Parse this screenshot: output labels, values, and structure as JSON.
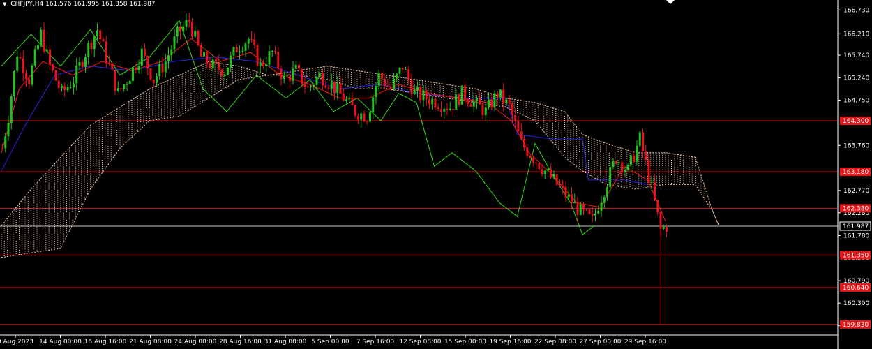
{
  "header": {
    "symbol": "CHFJPY,H4",
    "ohlc": "161.576 161.995 161.358 161.987"
  },
  "colors": {
    "background": "#000000",
    "axis": "#ffffff",
    "bull": "#22c41c",
    "bear": "#e8121a",
    "tenkan": "#ff1a1a",
    "kijun": "#2a22e8",
    "chikou": "#36d61a",
    "cloud": "#f0c8a8",
    "level": "#e0181c",
    "price_line": "#c8c8c8"
  },
  "chart_data": {
    "type": "candlestick",
    "price_axis_ticks": [
      166.73,
      166.21,
      165.74,
      165.24,
      164.75,
      163.76,
      162.77,
      162.28,
      161.78,
      161.29,
      160.79,
      160.3,
      159.8
    ],
    "x_tick_labels": [
      "9 Aug 2023",
      "14 Aug 00:00",
      "16 Aug 16:00",
      "21 Aug 08:00",
      "24 Aug 00:00",
      "28 Aug 16:00",
      "31 Aug 08:00",
      "5 Sep 00:00",
      "7 Sep 16:00",
      "12 Sep 08:00",
      "15 Sep 00:00",
      "19 Sep 16:00",
      "22 Sep 08:00",
      "27 Sep 00:00",
      "29 Sep 16:00"
    ],
    "levels": [
      {
        "value": 164.3,
        "label": "164.300"
      },
      {
        "value": 163.18,
        "label": "163.180"
      },
      {
        "value": 162.38,
        "label": "162.380"
      },
      {
        "value": 161.35,
        "label": "161.350"
      },
      {
        "value": 160.64,
        "label": "160.640"
      },
      {
        "value": 159.83,
        "label": "159.830"
      }
    ],
    "current_price": {
      "value": 161.987,
      "label": "161.987"
    },
    "ylim": [
      159.72,
      166.95
    ],
    "indicator": "Ichimoku Kinko Hyo",
    "trend": "range 165-166.6 in August, decline from mid-September to 161.99",
    "price_path": [
      [
        0,
        163.7
      ],
      [
        2,
        164.4
      ],
      [
        5,
        165.8
      ],
      [
        9,
        165.2
      ],
      [
        13,
        166.2
      ],
      [
        16,
        165.5
      ],
      [
        20,
        164.9
      ],
      [
        24,
        165.2
      ],
      [
        28,
        165.8
      ],
      [
        32,
        166.3
      ],
      [
        36,
        165.5
      ],
      [
        39,
        164.9
      ],
      [
        43,
        165.3
      ],
      [
        47,
        165.8
      ],
      [
        51,
        165.2
      ],
      [
        55,
        165.6
      ],
      [
        59,
        166.2
      ],
      [
        63,
        166.5
      ],
      [
        67,
        165.7
      ],
      [
        71,
        165.5
      ],
      [
        75,
        165.4
      ],
      [
        79,
        165.9
      ],
      [
        83,
        166.1
      ],
      [
        87,
        165.5
      ],
      [
        91,
        165.8
      ],
      [
        95,
        165.2
      ],
      [
        99,
        165.4
      ],
      [
        103,
        165.0
      ],
      [
        107,
        165.3
      ],
      [
        111,
        165.1
      ],
      [
        115,
        164.8
      ],
      [
        119,
        164.5
      ],
      [
        123,
        164.4
      ],
      [
        127,
        165.3
      ],
      [
        131,
        165.0
      ],
      [
        135,
        165.5
      ],
      [
        139,
        164.9
      ],
      [
        143,
        164.8
      ],
      [
        147,
        164.7
      ],
      [
        151,
        164.6
      ],
      [
        155,
        164.9
      ],
      [
        159,
        164.7
      ],
      [
        163,
        164.5
      ],
      [
        167,
        164.9
      ],
      [
        171,
        164.6
      ],
      [
        175,
        163.8
      ],
      [
        179,
        163.5
      ],
      [
        183,
        163.2
      ],
      [
        187,
        162.9
      ],
      [
        191,
        162.6
      ],
      [
        195,
        162.3
      ],
      [
        199,
        162.1
      ],
      [
        203,
        162.8
      ],
      [
        207,
        163.5
      ],
      [
        211,
        163.2
      ],
      [
        215,
        163.9
      ],
      [
        219,
        162.8
      ],
      [
        222,
        161.9
      ],
      [
        224,
        161.99
      ]
    ],
    "tenkan_path": [
      [
        0,
        163.6
      ],
      [
        6,
        165.0
      ],
      [
        14,
        165.6
      ],
      [
        24,
        165.3
      ],
      [
        34,
        165.6
      ],
      [
        44,
        165.4
      ],
      [
        54,
        165.6
      ],
      [
        64,
        166.1
      ],
      [
        74,
        165.6
      ],
      [
        84,
        165.8
      ],
      [
        94,
        165.3
      ],
      [
        104,
        165.1
      ],
      [
        114,
        164.8
      ],
      [
        124,
        164.8
      ],
      [
        134,
        165.1
      ],
      [
        144,
        164.9
      ],
      [
        154,
        164.8
      ],
      [
        164,
        164.7
      ],
      [
        172,
        164.3
      ],
      [
        178,
        163.6
      ],
      [
        186,
        163.1
      ],
      [
        194,
        162.5
      ],
      [
        202,
        162.4
      ],
      [
        210,
        163.3
      ],
      [
        218,
        163.0
      ],
      [
        224,
        162.1
      ]
    ],
    "kijun_path": [
      [
        0,
        163.2
      ],
      [
        8,
        164.2
      ],
      [
        18,
        165.3
      ],
      [
        30,
        165.5
      ],
      [
        44,
        165.4
      ],
      [
        58,
        165.6
      ],
      [
        72,
        165.7
      ],
      [
        86,
        165.6
      ],
      [
        100,
        165.3
      ],
      [
        114,
        165.0
      ],
      [
        128,
        165.1
      ],
      [
        140,
        164.9
      ],
      [
        156,
        164.8
      ],
      [
        170,
        164.8
      ],
      [
        174,
        164.0
      ],
      [
        186,
        163.9
      ],
      [
        196,
        163.9
      ],
      [
        198,
        163.0
      ],
      [
        210,
        163.0
      ],
      [
        218,
        162.9
      ]
    ],
    "chikou_path": [
      [
        0,
        165.5
      ],
      [
        10,
        166.2
      ],
      [
        20,
        165.5
      ],
      [
        30,
        166.3
      ],
      [
        40,
        165.3
      ],
      [
        50,
        165.7
      ],
      [
        60,
        166.5
      ],
      [
        68,
        165.0
      ],
      [
        76,
        164.5
      ],
      [
        86,
        165.3
      ],
      [
        96,
        164.8
      ],
      [
        104,
        165.2
      ],
      [
        112,
        164.5
      ],
      [
        120,
        164.8
      ],
      [
        128,
        164.3
      ],
      [
        134,
        164.9
      ],
      [
        140,
        164.7
      ],
      [
        146,
        163.3
      ],
      [
        152,
        163.6
      ],
      [
        160,
        163.2
      ],
      [
        168,
        162.5
      ],
      [
        174,
        162.2
      ],
      [
        180,
        163.8
      ],
      [
        186,
        163.1
      ],
      [
        192,
        162.5
      ],
      [
        196,
        161.8
      ],
      [
        200,
        162.0
      ]
    ],
    "cloud": {
      "upper": [
        [
          0,
          162.0
        ],
        [
          10,
          162.8
        ],
        [
          20,
          163.5
        ],
        [
          30,
          164.2
        ],
        [
          40,
          164.6
        ],
        [
          50,
          165.0
        ],
        [
          60,
          165.3
        ],
        [
          70,
          165.6
        ],
        [
          80,
          165.5
        ],
        [
          90,
          165.3
        ],
        [
          100,
          165.4
        ],
        [
          110,
          165.5
        ],
        [
          120,
          165.4
        ],
        [
          130,
          165.3
        ],
        [
          140,
          165.2
        ],
        [
          150,
          165.1
        ],
        [
          160,
          165.0
        ],
        [
          170,
          164.8
        ],
        [
          180,
          164.7
        ],
        [
          190,
          164.5
        ],
        [
          196,
          164.0
        ],
        [
          204,
          163.8
        ],
        [
          214,
          163.6
        ],
        [
          224,
          163.6
        ],
        [
          234,
          163.5
        ],
        [
          240,
          162.3
        ],
        [
          242,
          162.0
        ]
      ],
      "lower": [
        [
          0,
          161.3
        ],
        [
          10,
          161.4
        ],
        [
          20,
          161.5
        ],
        [
          30,
          162.8
        ],
        [
          40,
          163.7
        ],
        [
          50,
          164.3
        ],
        [
          60,
          164.4
        ],
        [
          70,
          164.8
        ],
        [
          80,
          165.2
        ],
        [
          90,
          165.3
        ],
        [
          100,
          165.3
        ],
        [
          110,
          165.2
        ],
        [
          120,
          165.0
        ],
        [
          130,
          165.0
        ],
        [
          140,
          164.9
        ],
        [
          150,
          164.8
        ],
        [
          160,
          164.7
        ],
        [
          170,
          164.6
        ],
        [
          180,
          164.3
        ],
        [
          190,
          163.5
        ],
        [
          196,
          163.2
        ],
        [
          204,
          162.9
        ],
        [
          214,
          162.8
        ],
        [
          224,
          162.9
        ],
        [
          234,
          162.9
        ],
        [
          240,
          162.3
        ],
        [
          242,
          162.0
        ]
      ]
    }
  }
}
